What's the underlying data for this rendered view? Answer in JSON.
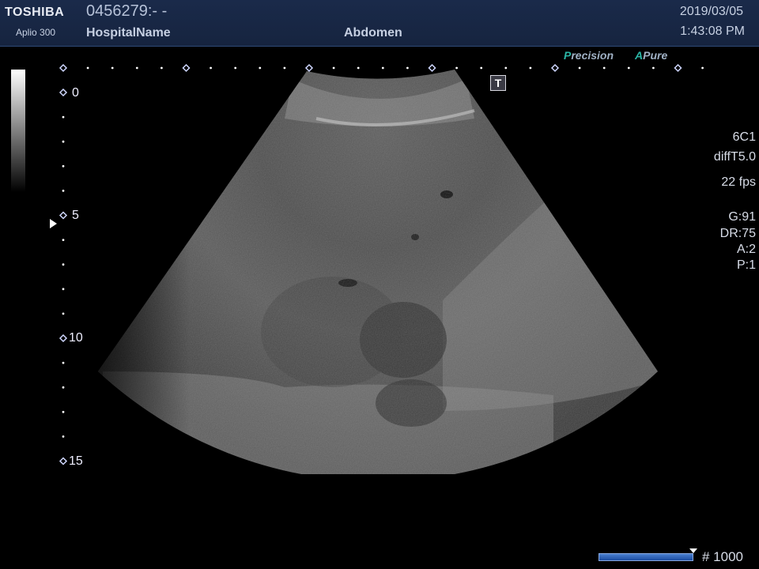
{
  "header": {
    "brand": "TOSHIBA",
    "model": "Aplio 300",
    "patient_id": "0456279:- -",
    "hospital": "HospitalName",
    "exam": "Abdomen",
    "date": "2019/03/05",
    "time": "1:43:08 PM"
  },
  "modes": {
    "precision_lead": "P",
    "precision_rest": "recision",
    "apure_lead": "A",
    "apure_rest": "Pure"
  },
  "badge": "T",
  "params": {
    "probe": "6C1",
    "preset": "diffT5.0",
    "fps": "22 fps",
    "gain": "G:91",
    "dynamic_range": "DR:75",
    "a": "A:2",
    "p": "P:1"
  },
  "depth_scale": {
    "labels": [
      "0",
      "5",
      "10",
      "15"
    ]
  },
  "cine": {
    "frame_count": "# 1000"
  },
  "colors": {
    "header_bg": "#1a2a4a",
    "accent_teal": "#2bb6a6",
    "cine_bar": "#3a6ec0",
    "marker_outline": "#d0d8ff"
  }
}
